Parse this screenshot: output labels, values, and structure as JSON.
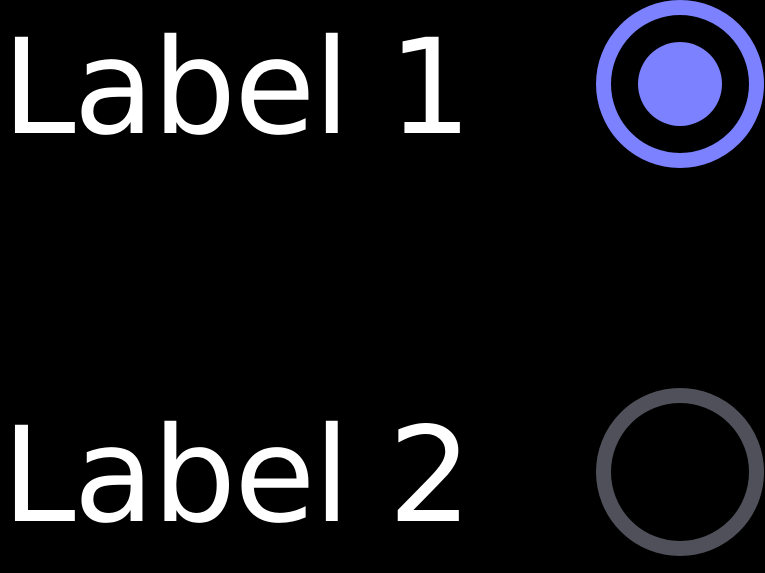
{
  "radio_group": {
    "options": [
      {
        "label": "Label 1",
        "checked": true
      },
      {
        "label": "Label 2",
        "checked": false
      }
    ]
  },
  "colors": {
    "background": "#000000",
    "text": "#ffffff",
    "accent_checked": "#7b81ff",
    "border_unchecked": "#50505a"
  }
}
